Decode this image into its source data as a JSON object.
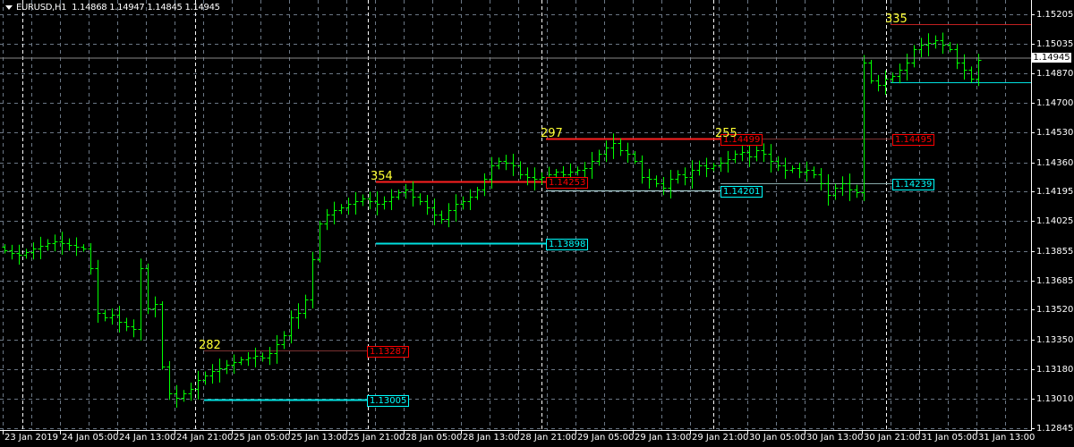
{
  "header": {
    "symbol": "EURUSD,H1",
    "ohlc": "1.14868 1.14947 1.14845 1.14945"
  },
  "price_axis": [
    "1.15205",
    "1.15035",
    "1.14870",
    "1.14700",
    "1.14530",
    "1.14360",
    "1.14195",
    "1.14025",
    "1.13855",
    "1.13685",
    "1.13520",
    "1.13350",
    "1.13180",
    "1.13010",
    "1.12845"
  ],
  "current_price": "1.14945",
  "time_axis": [
    "23 Jan 2019",
    "24 Jan 05:00",
    "24 Jan 13:00",
    "24 Jan 21:00",
    "25 Jan 05:00",
    "25 Jan 13:00",
    "25 Jan 21:00",
    "28 Jan 05:00",
    "28 Jan 13:00",
    "28 Jan 21:00",
    "29 Jan 05:00",
    "29 Jan 13:00",
    "29 Jan 21:00",
    "30 Jan 05:00",
    "30 Jan 13:00",
    "30 Jan 21:00",
    "31 Jan 05:00",
    "31 Jan 13:00"
  ],
  "colors": {
    "bars": "#00ff00",
    "resistance": "#ff0000",
    "support": "#00ffff",
    "count": "#ffff33",
    "grid": "#6b7785"
  },
  "zones": [
    {
      "count": "282",
      "high": "1.13287",
      "low": "1.13005"
    },
    {
      "count": "354",
      "high": "1.14253",
      "low": "1.13898"
    },
    {
      "count": "297",
      "high": "1.14499",
      "low": "1.14201"
    },
    {
      "count": "255",
      "high": "1.14495",
      "low": "1.14239"
    },
    {
      "count": "335",
      "high": "1.15150",
      "low": "1.14820"
    }
  ],
  "chart_data": {
    "type": "ohlc",
    "interval": "H1",
    "closes": [
      1.13859,
      1.13844,
      1.13834,
      1.13849,
      1.13869,
      1.13885,
      1.139,
      1.1391,
      1.139,
      1.1389,
      1.13879,
      1.13869,
      1.13757,
      1.13502,
      1.13477,
      1.13492,
      1.13451,
      1.13426,
      1.1341,
      1.13757,
      1.13528,
      1.13553,
      1.13196,
      1.13043,
      1.13018,
      1.13043,
      1.13069,
      1.1312,
      1.13145,
      1.13171,
      1.13186,
      1.13206,
      1.13222,
      1.13237,
      1.13247,
      1.13257,
      1.13247,
      1.13273,
      1.13324,
      1.13375,
      1.13477,
      1.13502,
      1.13579,
      1.13808,
      1.14012,
      1.14063,
      1.14089,
      1.14104,
      1.14124,
      1.1414,
      1.14155,
      1.1414,
      1.14124,
      1.1414,
      1.14165,
      1.14191,
      1.14206,
      1.14165,
      1.1414,
      1.14104,
      1.14063,
      1.14038,
      1.14089,
      1.14124,
      1.1414,
      1.14165,
      1.14206,
      1.14267,
      1.14344,
      1.14369,
      1.14359,
      1.14344,
      1.14293,
      1.14277,
      1.14267,
      1.14277,
      1.14293,
      1.14308,
      1.14293,
      1.14308,
      1.14318,
      1.14328,
      1.14369,
      1.1441,
      1.14446,
      1.14471,
      1.1443,
      1.1441,
      1.14369,
      1.14277,
      1.14267,
      1.14242,
      1.14216,
      1.14267,
      1.14293,
      1.14277,
      1.14318,
      1.14344,
      1.14328,
      1.14344,
      1.14359,
      1.14379,
      1.1441,
      1.1442,
      1.14395,
      1.1443,
      1.1441,
      1.14369,
      1.14344,
      1.14318,
      1.14328,
      1.14308,
      1.14318,
      1.14293,
      1.14242,
      1.14175,
      1.14216,
      1.14242,
      1.14206,
      1.14191,
      1.1493,
      1.14828,
      1.14803,
      1.14838,
      1.14854,
      1.14889,
      1.1493,
      1.15007,
      1.15032,
      1.15042,
      1.15058,
      1.15032,
      1.15007,
      1.1493,
      1.14889,
      1.14838,
      1.14945
    ],
    "ylim": [
      1.12845,
      1.15205
    ]
  }
}
